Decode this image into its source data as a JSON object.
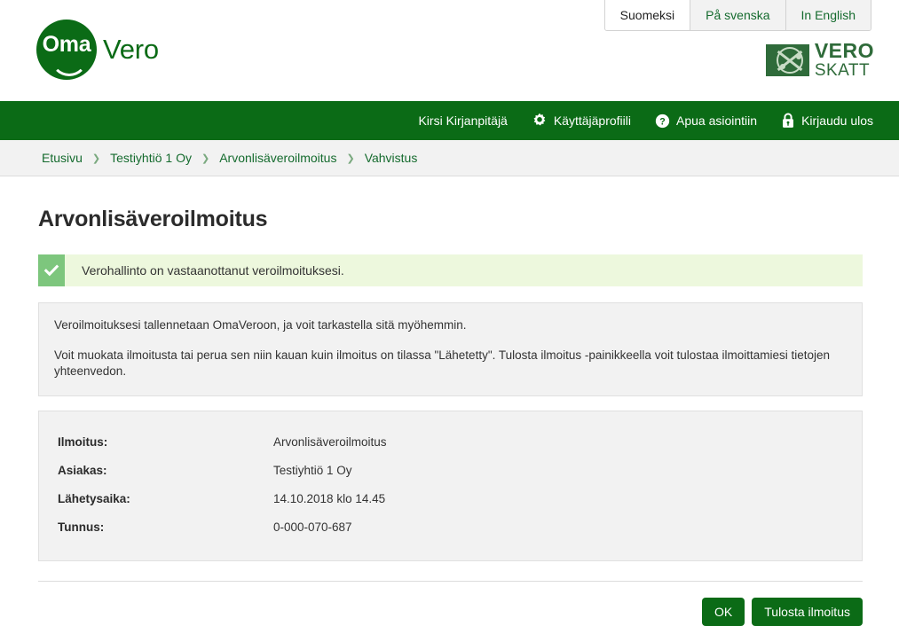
{
  "header": {
    "language_tabs": [
      {
        "label": "Suomeksi",
        "active": true
      },
      {
        "label": "På svenska",
        "active": false
      },
      {
        "label": "In English",
        "active": false
      }
    ],
    "logo": {
      "circle_text": "Oma",
      "word_text": "Vero",
      "icon": "omavero-smile-logo"
    },
    "agency_logo": {
      "line1": "VERO",
      "line2": "SKATT",
      "icon": "vero-skatt-emblem"
    }
  },
  "navbar": {
    "user_name": "Kirsi Kirjanpitäjä",
    "items": [
      {
        "label": "Käyttäjäprofiili",
        "icon": "gear-icon"
      },
      {
        "label": "Apua asiointiin",
        "icon": "question-circle-icon"
      },
      {
        "label": "Kirjaudu ulos",
        "icon": "lock-icon"
      }
    ]
  },
  "breadcrumb": {
    "separator": "❯",
    "items": [
      {
        "label": "Etusivu"
      },
      {
        "label": "Testiyhtiö 1 Oy"
      },
      {
        "label": "Arvonlisäveroilmoitus"
      },
      {
        "label": "Vahvistus"
      }
    ]
  },
  "main": {
    "page_title": "Arvonlisäveroilmoitus",
    "success_banner": {
      "icon": "checkmark-icon",
      "text": "Verohallinto on vastaanottanut veroilmoituksesi."
    },
    "info": {
      "paragraph1": "Veroilmoituksesi tallennetaan OmaVeroon, ja voit tarkastella sitä myöhemmin.",
      "paragraph2": "Voit muokata ilmoitusta tai perua sen niin kauan kuin ilmoitus on tilassa \"Lähetetty\". Tulosta ilmoitus -painikkeella voit tulostaa ilmoittamiesi tietojen yhteenvedon."
    },
    "details": [
      {
        "label": "Ilmoitus:",
        "value": "Arvonlisäveroilmoitus"
      },
      {
        "label": "Asiakas:",
        "value": "Testiyhtiö 1 Oy"
      },
      {
        "label": "Lähetysaika:",
        "value": "14.10.2018 klo 14.45"
      },
      {
        "label": "Tunnus:",
        "value": "0-000-070-687"
      }
    ],
    "actions": {
      "ok_label": "OK",
      "print_label": "Tulosta ilmoitus"
    }
  },
  "colors": {
    "brand_green": "#0b6b16",
    "link_green": "#156b2e",
    "success_bg": "#edf8dd",
    "success_icon_bg": "#7dc67d",
    "panel_bg": "#f2f2f2"
  }
}
